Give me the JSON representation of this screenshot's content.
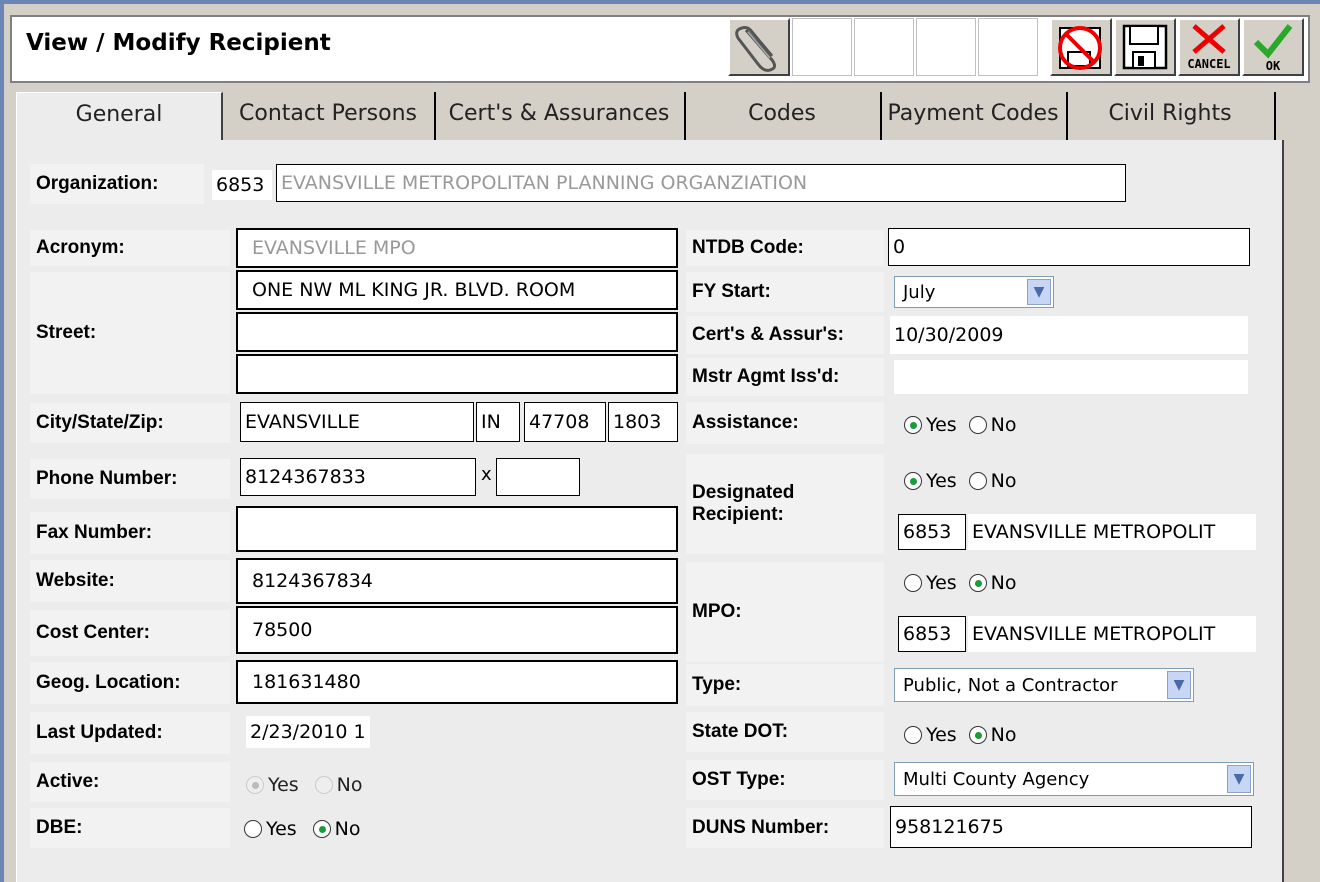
{
  "window": {
    "title": "View / Modify Recipient"
  },
  "toolbar": {
    "attach_icon": "paperclip-icon",
    "cancel_label": "CANCEL",
    "ok_label": "OK"
  },
  "tabs": [
    "General",
    "Contact Persons",
    "Cert's & Assurances",
    "Codes",
    "Payment Codes",
    "Civil Rights"
  ],
  "organization": {
    "label": "Organization:",
    "id": "6853",
    "name": "EVANSVILLE METROPOLITAN PLANNING ORGANZIATION"
  },
  "left": {
    "acronym": {
      "label": "Acronym:",
      "value": "EVANSVILLE MPO"
    },
    "street": {
      "label": "Street:",
      "line1": "ONE NW ML KING JR. BLVD. ROOM",
      "line2": "",
      "line3": ""
    },
    "city_state_zip": {
      "label": "City/State/Zip:",
      "city": "EVANSVILLE",
      "state": "IN",
      "zip": "47708",
      "zip4": "1803"
    },
    "phone": {
      "label": "Phone Number:",
      "value": "8124367833",
      "ext_sep": "x",
      "ext": ""
    },
    "fax": {
      "label": "Fax Number:",
      "value": ""
    },
    "website": {
      "label": "Website:",
      "value": "8124367834"
    },
    "cost_center": {
      "label": "Cost Center:",
      "value": "78500"
    },
    "geog_location": {
      "label": "Geog. Location:",
      "value": "181631480"
    },
    "last_updated": {
      "label": "Last Updated:",
      "value": "2/23/2010 1"
    },
    "active": {
      "label": "Active:",
      "yes": "Yes",
      "no": "No",
      "selected": "Yes"
    },
    "dbe": {
      "label": "DBE:",
      "yes": "Yes",
      "no": "No",
      "selected": "No"
    }
  },
  "right": {
    "ntdb_code": {
      "label": "NTDB Code:",
      "value": "0"
    },
    "fy_start": {
      "label": "FY Start:",
      "value": "July"
    },
    "certs_assurs": {
      "label": "Cert's & Assur's:",
      "value": "10/30/2009"
    },
    "mstr_agmt": {
      "label": "Mstr Agmt Iss'd:",
      "value": ""
    },
    "assistance": {
      "label": "Assistance:",
      "yes": "Yes",
      "no": "No",
      "selected": "Yes"
    },
    "designated": {
      "label_line1": "Designated",
      "label_line2": "Recipient:",
      "yes": "Yes",
      "no": "No",
      "selected": "Yes",
      "id": "6853",
      "name": "EVANSVILLE METROPOLIT"
    },
    "mpo": {
      "label": "MPO:",
      "yes": "Yes",
      "no": "No",
      "selected": "No",
      "id": "6853",
      "name": "EVANSVILLE METROPOLIT"
    },
    "type": {
      "label": "Type:",
      "value": "Public, Not a Contractor"
    },
    "state_dot": {
      "label": "State DOT:",
      "yes": "Yes",
      "no": "No",
      "selected": "No"
    },
    "ost_type": {
      "label": "OST Type:",
      "value": "Multi County Agency"
    },
    "duns": {
      "label": "DUNS Number:",
      "value": "958121675"
    }
  }
}
